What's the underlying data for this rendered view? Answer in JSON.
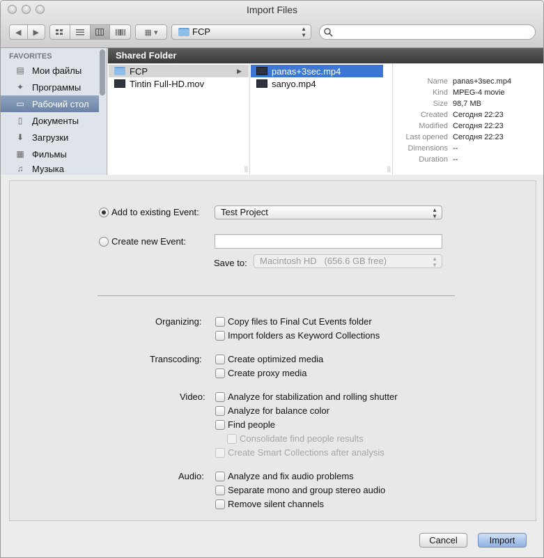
{
  "window": {
    "title": "Import Files"
  },
  "toolbar": {
    "back_icon": "chevron-left-icon",
    "forward_icon": "chevron-right-icon",
    "view_icons": [
      "icon-view-icon",
      "list-view-icon",
      "column-view-icon",
      "coverflow-view-icon"
    ],
    "arrange_icon": "arrange-grid-icon",
    "location": "FCP",
    "search_placeholder": ""
  },
  "sidebar": {
    "heading": "FAVORITES",
    "items": [
      {
        "label": "Мои файлы",
        "icon": "all-files-icon",
        "selected": false
      },
      {
        "label": "Программы",
        "icon": "applications-icon",
        "selected": false
      },
      {
        "label": "Рабочий стол",
        "icon": "desktop-icon",
        "selected": true
      },
      {
        "label": "Документы",
        "icon": "documents-icon",
        "selected": false
      },
      {
        "label": "Загрузки",
        "icon": "downloads-icon",
        "selected": false
      },
      {
        "label": "Фильмы",
        "icon": "movies-icon",
        "selected": false
      },
      {
        "label": "Музыка",
        "icon": "music-icon",
        "selected": false
      }
    ]
  },
  "browser": {
    "column_header": "Shared Folder",
    "col1": [
      {
        "name": "FCP",
        "kind": "folder"
      },
      {
        "name": "Tintin Full-HD.mov",
        "kind": "movie"
      }
    ],
    "col2": [
      {
        "name": "panas+3sec.mp4",
        "kind": "movie"
      },
      {
        "name": "sanyo.mp4",
        "kind": "movie"
      }
    ]
  },
  "info": {
    "rows": [
      {
        "key": "Name",
        "value": "panas+3sec.mp4"
      },
      {
        "key": "Kind",
        "value": "MPEG-4 movie"
      },
      {
        "key": "Size",
        "value": "98,7 MB"
      },
      {
        "key": "Created",
        "value": "Сегодня 22:23"
      },
      {
        "key": "Modified",
        "value": "Сегодня 22:23"
      },
      {
        "key": "Last opened",
        "value": "Сегодня 22:23"
      },
      {
        "key": "Dimensions",
        "value": "--"
      },
      {
        "key": "Duration",
        "value": "--"
      }
    ]
  },
  "event": {
    "add_existing_label": "Add to existing Event:",
    "existing_event_value": "Test Project",
    "create_new_label": "Create new Event:",
    "new_event_value": "",
    "save_to_label": "Save to:",
    "save_to_value": "Macintosh HD   (656.6 GB free)"
  },
  "options": {
    "organizing": {
      "label": "Organizing:",
      "items": [
        "Copy files to Final Cut Events folder",
        "Import folders as Keyword Collections"
      ]
    },
    "transcoding": {
      "label": "Transcoding:",
      "items": [
        "Create optimized media",
        "Create proxy media"
      ]
    },
    "video": {
      "label": "Video:",
      "items": [
        "Analyze for stabilization and rolling shutter",
        "Analyze for balance color",
        "Find people",
        "Consolidate find people results",
        "Create Smart Collections after analysis"
      ]
    },
    "audio": {
      "label": "Audio:",
      "items": [
        "Analyze and fix audio problems",
        "Separate mono and group stereo audio",
        "Remove silent channels"
      ]
    }
  },
  "buttons": {
    "cancel": "Cancel",
    "import": "Import"
  },
  "colors": {
    "selection_blue": "#3b78d6",
    "sidebar_bg": "#dee4ea",
    "header_dark": "#4a4a4a"
  }
}
